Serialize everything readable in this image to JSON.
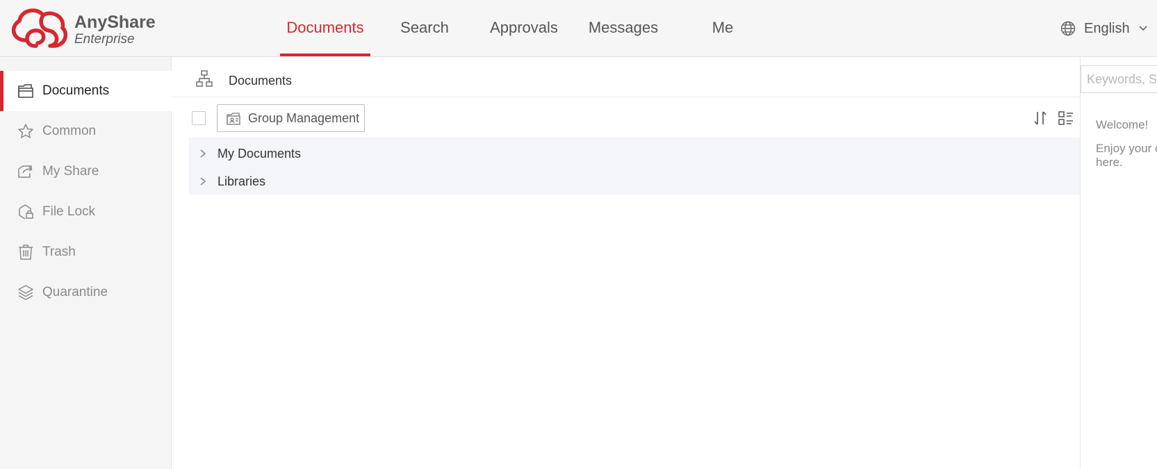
{
  "app": {
    "logo_name": "AnyShare",
    "logo_sub": "Enterprise",
    "brand_color": "#d8272e"
  },
  "header": {
    "nav": [
      {
        "label": "Documents",
        "active": true
      },
      {
        "label": "Search",
        "active": false
      },
      {
        "label": "Approvals",
        "active": false
      },
      {
        "label": "Messages",
        "active": false
      },
      {
        "label": "Me",
        "active": false
      }
    ],
    "language": {
      "label": "English",
      "icon": "globe-icon",
      "dropdown_icon": "chevron-down-icon"
    }
  },
  "sidebar": {
    "items": [
      {
        "label": "Documents",
        "icon": "folder-icon",
        "active": true
      },
      {
        "label": "Common",
        "icon": "star-icon",
        "active": false
      },
      {
        "label": "My Share",
        "icon": "share-icon",
        "active": false
      },
      {
        "label": "File Lock",
        "icon": "file-lock-icon",
        "active": false
      },
      {
        "label": "Trash",
        "icon": "trash-icon",
        "active": false
      },
      {
        "label": "Quarantine",
        "icon": "layers-icon",
        "active": false
      }
    ]
  },
  "main": {
    "breadcrumb": {
      "label": "Documents",
      "icon": "tree-structure-icon"
    },
    "toolbar": {
      "group_button": "Group Management",
      "sort_icon": "sort-icon",
      "view_icon": "list-view-icon"
    },
    "tree": [
      {
        "label": "My Documents"
      },
      {
        "label": "Libraries"
      }
    ]
  },
  "right_panel": {
    "search_placeholder": "Keywords, Sh",
    "welcome": "Welcome!",
    "enjoy": "Enjoy your c here."
  }
}
